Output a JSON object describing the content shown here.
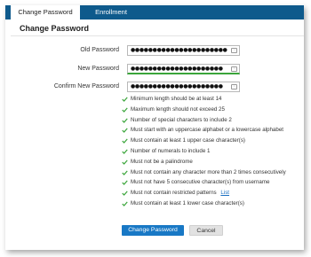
{
  "tabs": [
    {
      "label": "Change Password"
    },
    {
      "label": "Enrollment"
    }
  ],
  "page_title": "Change Password",
  "fields": [
    {
      "label": "Old Password",
      "value": "●●●●●●●●●●●●●●●●●●●●●●"
    },
    {
      "label": "New Password",
      "value": "●●●●●●●●●●●●●●●●●●●●●"
    },
    {
      "label": "Confirm New Password",
      "value": "●●●●●●●●●●●●●●●●●●●●●"
    }
  ],
  "rules": [
    {
      "text": "Minimum length should be at least 14"
    },
    {
      "text": "Maximum length should not exceed 25"
    },
    {
      "text": "Number of special characters to include 2"
    },
    {
      "text": "Must start with an uppercase alphabet or a lowercase alphabet"
    },
    {
      "text": "Must contain at least 1 upper case character(s)"
    },
    {
      "text": "Number of numerals to include 1"
    },
    {
      "text": "Must not be a palindrome"
    },
    {
      "text": "Must not contain any character more than 2 times consecutively"
    },
    {
      "text": "Must not have 5 consecutive character(s) from username"
    },
    {
      "text": "Must not contain restricted patterns",
      "link": "List"
    },
    {
      "text": "Must contain at least 1 lower case character(s)"
    }
  ],
  "buttons": {
    "submit": "Change Password",
    "cancel": "Cancel"
  },
  "colors": {
    "tab_bar": "#0e5a8c",
    "primary": "#1878c5",
    "check": "#3aa53a",
    "link": "#1a6fc2"
  },
  "icons": {
    "field_toggle": "eye-icon",
    "rule_status": "check-icon"
  }
}
